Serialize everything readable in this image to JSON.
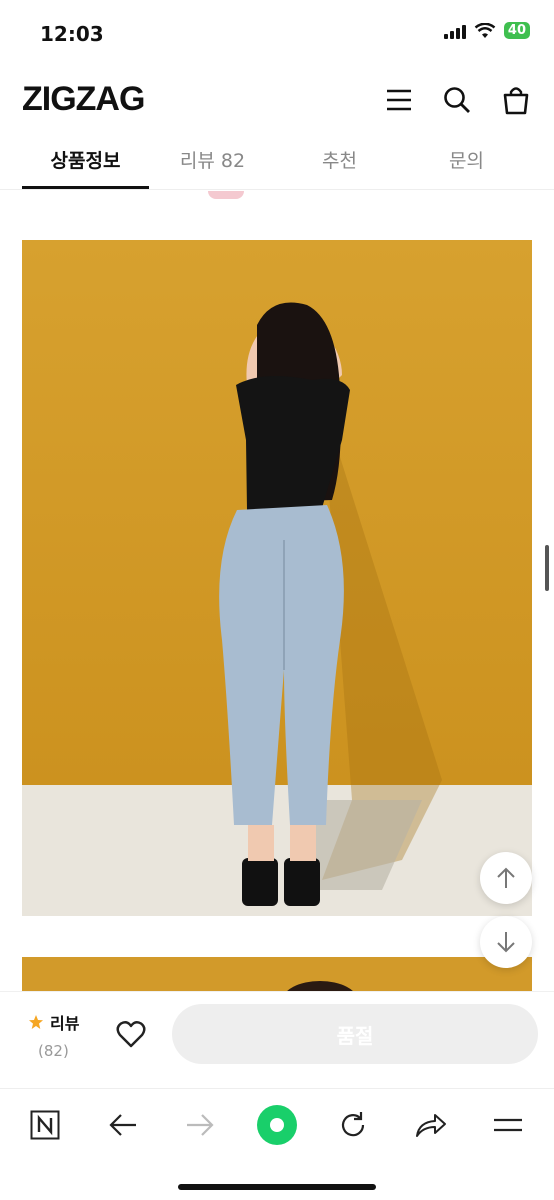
{
  "status": {
    "time": "12:03",
    "battery": "40"
  },
  "app": {
    "logo": "ZIGZAG"
  },
  "tabs": [
    {
      "label": "상품정보",
      "active": true
    },
    {
      "label": "리뷰 82",
      "active": false
    },
    {
      "label": "추천",
      "active": false
    },
    {
      "label": "문의",
      "active": false
    }
  ],
  "icons": {
    "header": [
      "menu-icon",
      "search-icon",
      "shopping-bag-icon"
    ],
    "floating": [
      "arrow-up-icon",
      "arrow-down-icon"
    ],
    "browser": [
      "naver-n-icon",
      "back-arrow-icon",
      "forward-arrow-icon",
      "green-circle-home-icon",
      "refresh-icon",
      "share-icon",
      "menu-lines-icon"
    ]
  },
  "bottom_bar": {
    "review_label": "리뷰",
    "review_count": "(82)",
    "soldout_label": "품절"
  },
  "colors": {
    "accent_green": "#19cf6a",
    "star": "#f5a623",
    "wall": "#d29a2a",
    "jeans": "#a8bcd0"
  }
}
